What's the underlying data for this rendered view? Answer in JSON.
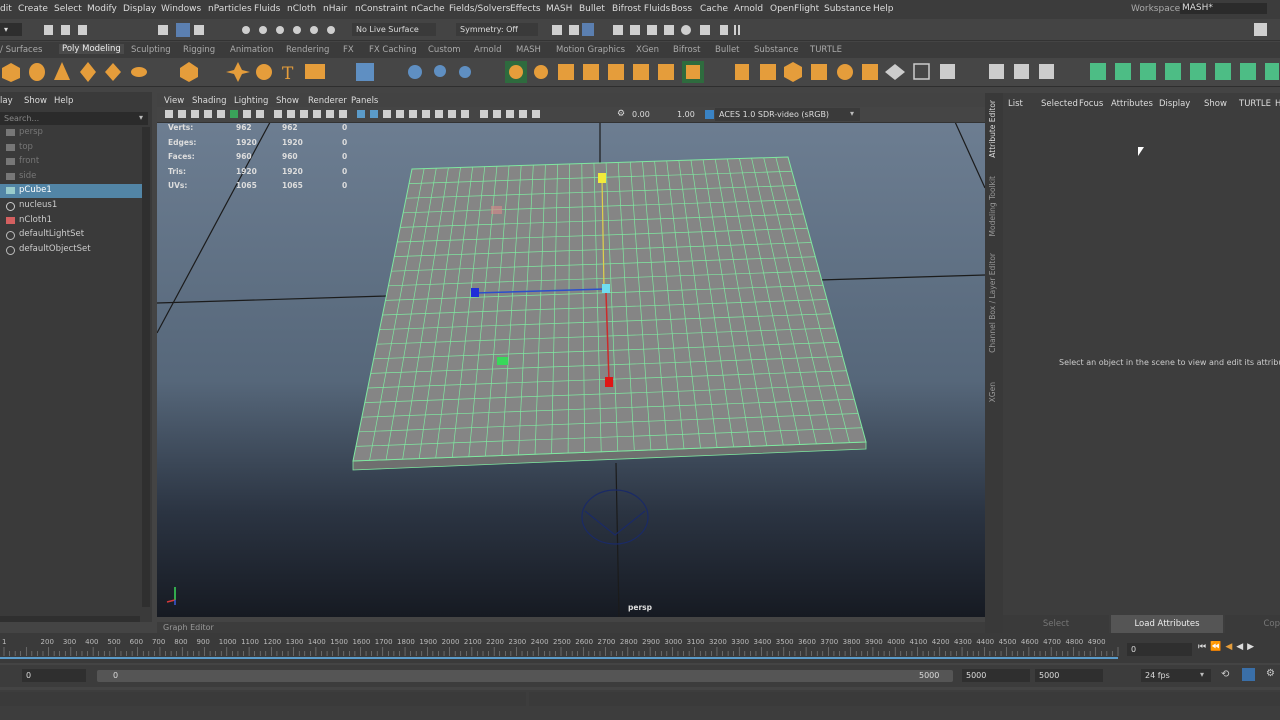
{
  "menubar": {
    "items": [
      "dit",
      "Create",
      "Select",
      "Modify",
      "Display",
      "Windows",
      "nParticles",
      "Fluids",
      "nCloth",
      "nHair",
      "nConstraint",
      "nCache",
      "Fields/Solvers",
      "Effects",
      "MASH",
      "Bullet",
      "Bifrost Fluids",
      "Boss",
      "Cache",
      "Arnold",
      "OpenFlight",
      "Substance",
      "Help"
    ],
    "workspace_label": "Workspace:",
    "workspace_value": "MASH*"
  },
  "statusline": {
    "live_surface": "No Live Surface",
    "symmetry": "Symmetry: Off"
  },
  "shelf_tabs": {
    "items": [
      "/ Surfaces",
      "Poly Modeling",
      "Sculpting",
      "Rigging",
      "Animation",
      "Rendering",
      "FX",
      "FX Caching",
      "Custom",
      "Arnold",
      "MASH",
      "Motion Graphics",
      "XGen",
      "Bifrost",
      "Bullet",
      "Substance",
      "TURTLE"
    ],
    "active": "Poly Modeling"
  },
  "outliner": {
    "menu": [
      "lay",
      "Show",
      "Help"
    ],
    "search_placeholder": "Search...",
    "items": [
      {
        "label": "persp",
        "dim": true,
        "icon": "camera-icon"
      },
      {
        "label": "top",
        "dim": true,
        "icon": "camera-icon"
      },
      {
        "label": "front",
        "dim": true,
        "icon": "camera-icon"
      },
      {
        "label": "side",
        "dim": true,
        "icon": "camera-icon"
      },
      {
        "label": "pCube1",
        "selected": true,
        "icon": "mesh-icon"
      },
      {
        "label": "nucleus1",
        "icon": "nucleus-icon"
      },
      {
        "label": "nCloth1",
        "icon": "ncloth-icon"
      },
      {
        "label": "defaultLightSet",
        "icon": "set-icon"
      },
      {
        "label": "defaultObjectSet",
        "icon": "set-icon"
      }
    ]
  },
  "viewport": {
    "menu": [
      "View",
      "Shading",
      "Lighting",
      "Show",
      "Renderer",
      "Panels"
    ],
    "exposure": "0.00",
    "gamma": "1.00",
    "color_space": "ACES 1.0 SDR-video (sRGB)",
    "camera_label": "persp",
    "hud": [
      {
        "label": "Verts:",
        "a": "962",
        "b": "962",
        "c": "0"
      },
      {
        "label": "Edges:",
        "a": "1920",
        "b": "1920",
        "c": "0"
      },
      {
        "label": "Faces:",
        "a": "960",
        "b": "960",
        "c": "0"
      },
      {
        "label": "Tris:",
        "a": "1920",
        "b": "1920",
        "c": "0"
      },
      {
        "label": "UVs:",
        "a": "1065",
        "b": "1065",
        "c": "0"
      }
    ],
    "graph_editor_label": "Graph Editor"
  },
  "attribute_editor": {
    "menu": [
      "List",
      "Selected",
      "Focus",
      "Attributes",
      "Display",
      "Show",
      "TURTLE",
      "Help"
    ],
    "message": "Select an object in the scene to view and edit its attributes",
    "select_button": "Select",
    "load_button": "Load Attributes",
    "copy_button": "Cop",
    "side_tabs": [
      "Attribute Editor",
      "Modeling Toolkit",
      "Channel Box / Layer Editor",
      "XGen"
    ]
  },
  "timeline": {
    "ticks": [
      "1",
      "200",
      "300",
      "400",
      "500",
      "600",
      "700",
      "800",
      "900",
      "1000",
      "1100",
      "1200",
      "1300",
      "1400",
      "1500",
      "1600",
      "1700",
      "1800",
      "1900",
      "2000",
      "2100",
      "2200",
      "2300",
      "2400",
      "2500",
      "2600",
      "2700",
      "2800",
      "2900",
      "3000",
      "3100",
      "3200",
      "3300",
      "3400",
      "3500",
      "3600",
      "3700",
      "3800",
      "3900",
      "4000",
      "4100",
      "4200",
      "4300",
      "4400",
      "4500",
      "4600",
      "4700",
      "4800",
      "4900"
    ],
    "current_frame": "0"
  },
  "range": {
    "start": "0",
    "inner_start": "0",
    "inner_end": "5000",
    "end_a": "5000",
    "end_b": "5000",
    "fps": "24 fps"
  },
  "colors": {
    "accent": "#5b9bc9",
    "wire": "#7fe8a0",
    "plane": "#858585"
  }
}
